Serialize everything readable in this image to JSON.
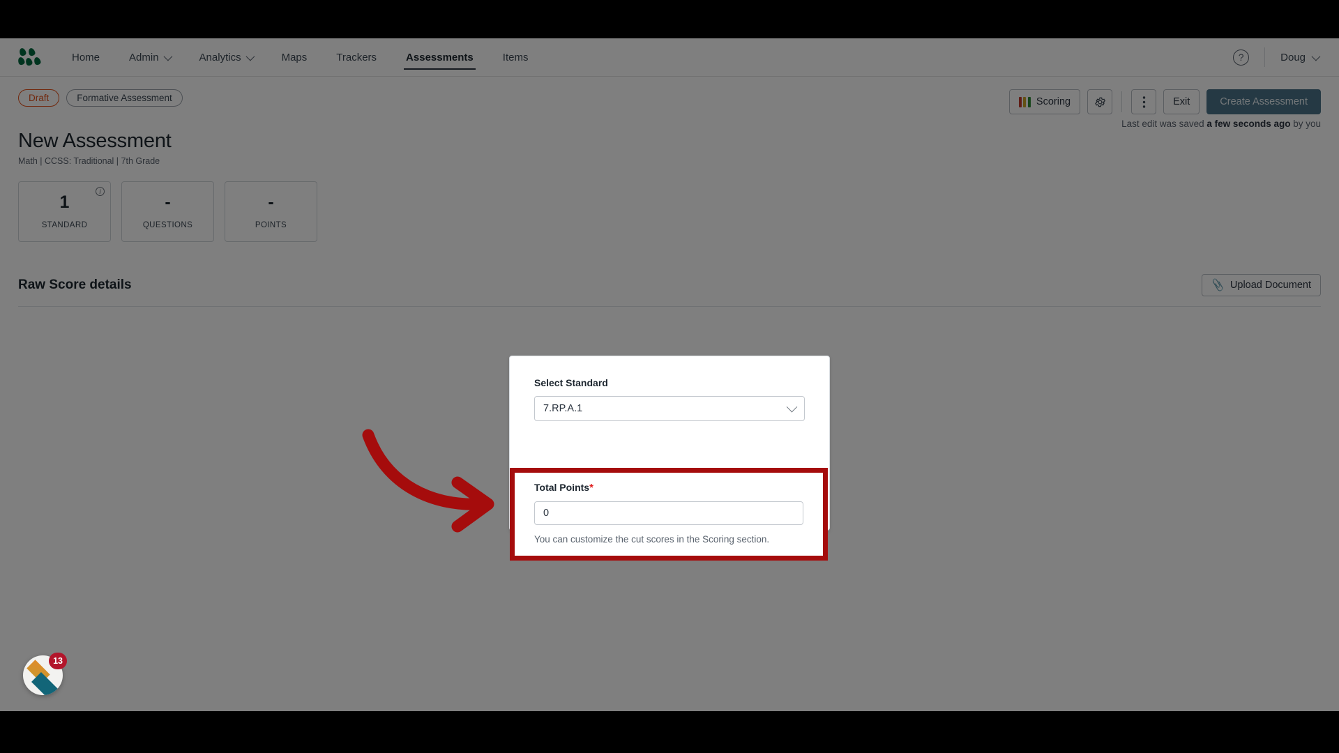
{
  "nav": {
    "logo_icon": "five-dot-leaf-logo",
    "items": [
      {
        "label": "Home",
        "has_caret": false,
        "active": false
      },
      {
        "label": "Admin",
        "has_caret": true,
        "active": false
      },
      {
        "label": "Analytics",
        "has_caret": true,
        "active": false
      },
      {
        "label": "Maps",
        "has_caret": false,
        "active": false
      },
      {
        "label": "Trackers",
        "has_caret": false,
        "active": false
      },
      {
        "label": "Assessments",
        "has_caret": false,
        "active": true
      },
      {
        "label": "Items",
        "has_caret": false,
        "active": false
      }
    ],
    "help_icon": "question-mark-circle-icon",
    "user": "Doug"
  },
  "actionbar": {
    "status_chip": "Draft",
    "type_chip": "Formative Assessment",
    "scoring_label": "Scoring",
    "scoring_colors": [
      "#c0392b",
      "#c9a227",
      "#2e8b35"
    ],
    "settings_icon": "gear-icon",
    "more_icon": "kebab-menu-icon",
    "exit_label": "Exit",
    "create_label": "Create Assessment",
    "saved_prefix": "Last edit was saved ",
    "saved_bold": "a few seconds ago",
    "saved_suffix": " by you"
  },
  "page": {
    "title": "New Assessment",
    "subtitle": "Math  |  CCSS: Traditional  |  7th Grade"
  },
  "stats": [
    {
      "value": "1",
      "label": "STANDARD",
      "info": true
    },
    {
      "value": "-",
      "label": "QUESTIONS",
      "info": false
    },
    {
      "value": "-",
      "label": "POINTS",
      "info": false
    }
  ],
  "section": {
    "title": "Raw Score details",
    "upload_label": "Upload Document",
    "upload_icon": "paperclip-icon"
  },
  "panel": {
    "standard_label": "Select Standard",
    "standard_value": "7.RP.A.1",
    "standard_chevron_icon": "chevron-down-icon",
    "points_label": "Total Points",
    "points_required_mark": "*",
    "points_value": "0",
    "helper_text": "You can customize the cut scores in the Scoring section."
  },
  "annotation": {
    "arrow_icon": "curved-right-arrow-icon",
    "arrow_color": "#a50c0c",
    "highlight_color": "#a50c0c"
  },
  "widget": {
    "icon": "diamond-stack-logo",
    "badge_count": "13"
  }
}
